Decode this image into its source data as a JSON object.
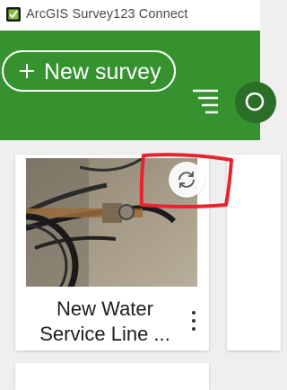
{
  "window": {
    "title": "ArcGIS Survey123 Connect"
  },
  "toolbar": {
    "new_survey_label": "New survey"
  },
  "surveys": [
    {
      "title_line1": "New Water",
      "title_line2": "Service Line ..."
    }
  ],
  "icons": {
    "app": "survey123-app-icon",
    "add": "plus-icon",
    "menu": "hamburger-menu-icon",
    "search": "search-icon",
    "sync": "sync-icon",
    "more": "more-vertical-icon"
  },
  "colors": {
    "header": "#35922f",
    "search_bg": "#2b6e27",
    "annotation": "#e8232e"
  }
}
